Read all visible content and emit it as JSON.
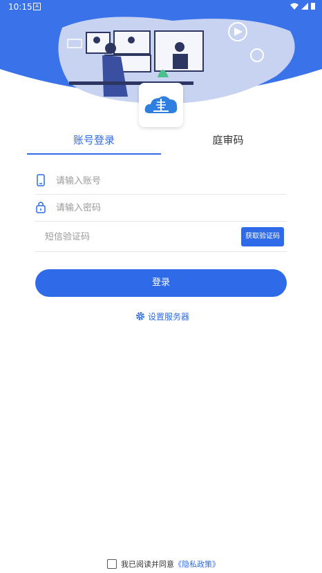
{
  "status_bar": {
    "time": "10:15",
    "notification_icon": "A"
  },
  "tabs": [
    {
      "label": "账号登录",
      "active": true
    },
    {
      "label": "庭审码",
      "active": false
    }
  ],
  "form": {
    "account_placeholder": "请输入账号",
    "password_placeholder": "请输入密码",
    "sms_placeholder": "短信验证码",
    "get_code_label": "获取验证码"
  },
  "login_label": "登录",
  "server_label": "设置服务器",
  "agreement": {
    "prefix": "我已阅读并同意",
    "link": "《隐私政策》"
  },
  "colors": {
    "accent": "#2f6be8",
    "header_blue": "#3a72ea"
  },
  "icons": [
    "phone-icon",
    "lock-icon",
    "gear-icon",
    "court-logo-icon",
    "wifi-icon",
    "signal-icon",
    "battery-icon"
  ]
}
